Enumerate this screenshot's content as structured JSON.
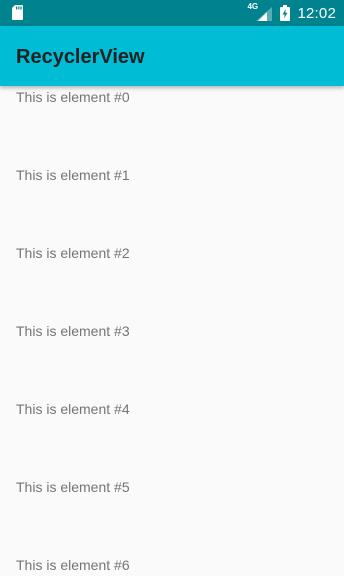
{
  "status_bar": {
    "left_icon": "sd-card-icon",
    "network_type": "4G",
    "signal_icon": "cell-signal-icon",
    "battery_icon": "battery-charging-icon",
    "time": "12:02",
    "color": "#00838f"
  },
  "app_bar": {
    "title": "RecyclerView",
    "color": "#00bcd4"
  },
  "list": {
    "items": [
      {
        "label": "This is element #0"
      },
      {
        "label": "This is element #1"
      },
      {
        "label": "This is element #2"
      },
      {
        "label": "This is element #3"
      },
      {
        "label": "This is element #4"
      },
      {
        "label": "This is element #5"
      },
      {
        "label": "This is element #6"
      }
    ]
  }
}
